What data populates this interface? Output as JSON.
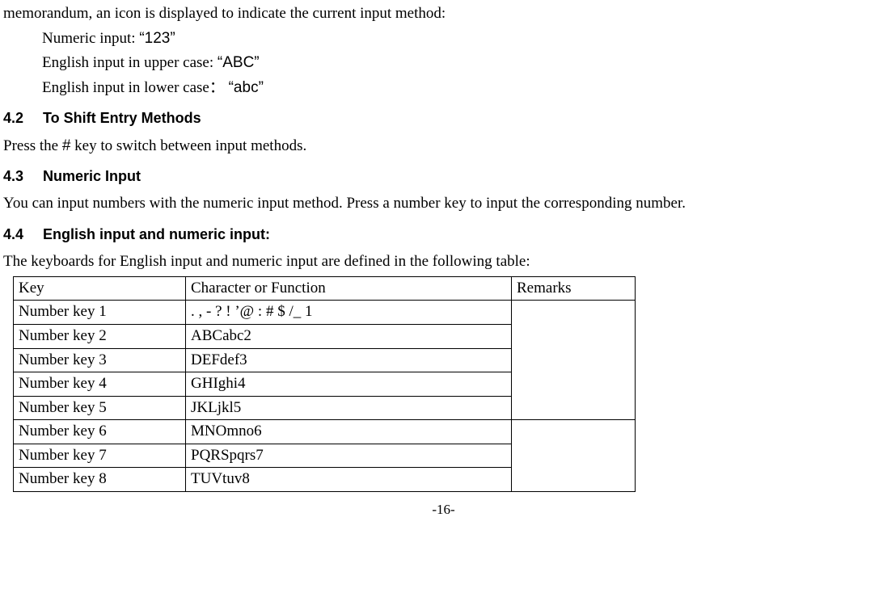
{
  "intro": {
    "line1": "memorandum, an icon is displayed to indicate the current input method:",
    "numeric_label": "Numeric input:",
    "numeric_value": "“123”",
    "upper_label": "English input in upper case:",
    "upper_value": "“ABC”",
    "lower_label": "English input in lower case：",
    "lower_value": "“abc”"
  },
  "s42": {
    "num": "4.2",
    "title": "To Shift Entry Methods",
    "body_a": "Press the ",
    "body_hash": "#",
    "body_b": " key to switch between input methods."
  },
  "s43": {
    "num": "4.3",
    "title": "Numeric Input",
    "body": "You can input numbers with the numeric input method. Press a number key to input the corresponding number."
  },
  "s44": {
    "num": "4.4",
    "title": "English input and numeric input:",
    "body": "The keyboards for English input and numeric input are defined in the following table:"
  },
  "table": {
    "headers": {
      "key": "Key",
      "char": "Character or Function",
      "remarks": "Remarks"
    },
    "rows": [
      {
        "key": "Number key 1",
        "char": ". , - ? ! ’@ : # $ /_ 1"
      },
      {
        "key": "Number key 2",
        "char": "ABCabc2"
      },
      {
        "key": "Number key 3",
        "char": "DEFdef3"
      },
      {
        "key": "Number key 4",
        "char": "GHIghi4"
      },
      {
        "key": "Number key 5",
        "char": "JKLjkl5"
      },
      {
        "key": "Number key 6",
        "char": "MNOmno6"
      },
      {
        "key": "Number key 7",
        "char": "PQRSpqrs7"
      },
      {
        "key": "Number key 8",
        "char": "TUVtuv8"
      }
    ]
  },
  "page": "-16-"
}
